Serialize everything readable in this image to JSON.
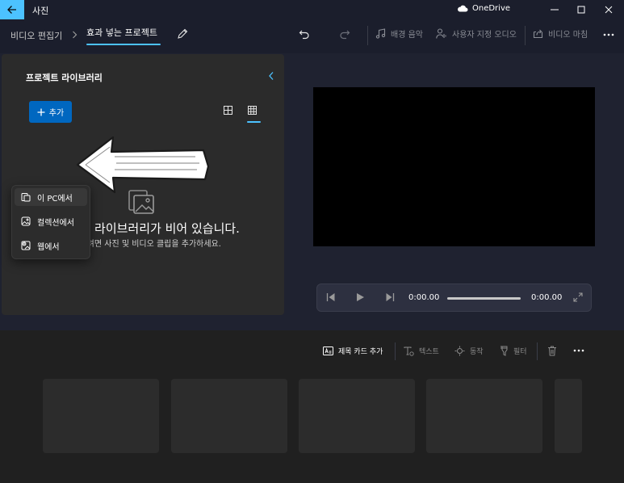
{
  "titlebar": {
    "app_title": "사진",
    "onedrive_label": "OneDrive"
  },
  "commandbar": {
    "breadcrumb_editor": "비디오 편집기",
    "breadcrumb_project": "효과 넣는 프로젝트",
    "background_music": "배경 음악",
    "custom_audio": "사용자 지정 오디오",
    "finish_video": "비디오 마침"
  },
  "library": {
    "title": "프로젝트 라이브러리",
    "add_label": "추가",
    "empty_title": "프로젝트 라이브러리가 비어 있습니다.",
    "empty_subtitle": "시작하려면 사진 및 비디오 클립을 추가하세요."
  },
  "add_menu": {
    "items": [
      {
        "label": "이 PC에서",
        "icon": "folder-icon"
      },
      {
        "label": "컬렉션에서",
        "icon": "photo-collection-icon"
      },
      {
        "label": "웹에서",
        "icon": "web-image-icon"
      }
    ]
  },
  "player": {
    "current_time": "0:00.00",
    "total_time": "0:00.00",
    "progress": 0
  },
  "storyboard": {
    "add_title_card": "제목 카드 추가",
    "text": "텍스트",
    "motion": "동작",
    "filters": "필터"
  },
  "colors": {
    "accent": "#4cc2ff",
    "button_blue": "#0067c0"
  }
}
